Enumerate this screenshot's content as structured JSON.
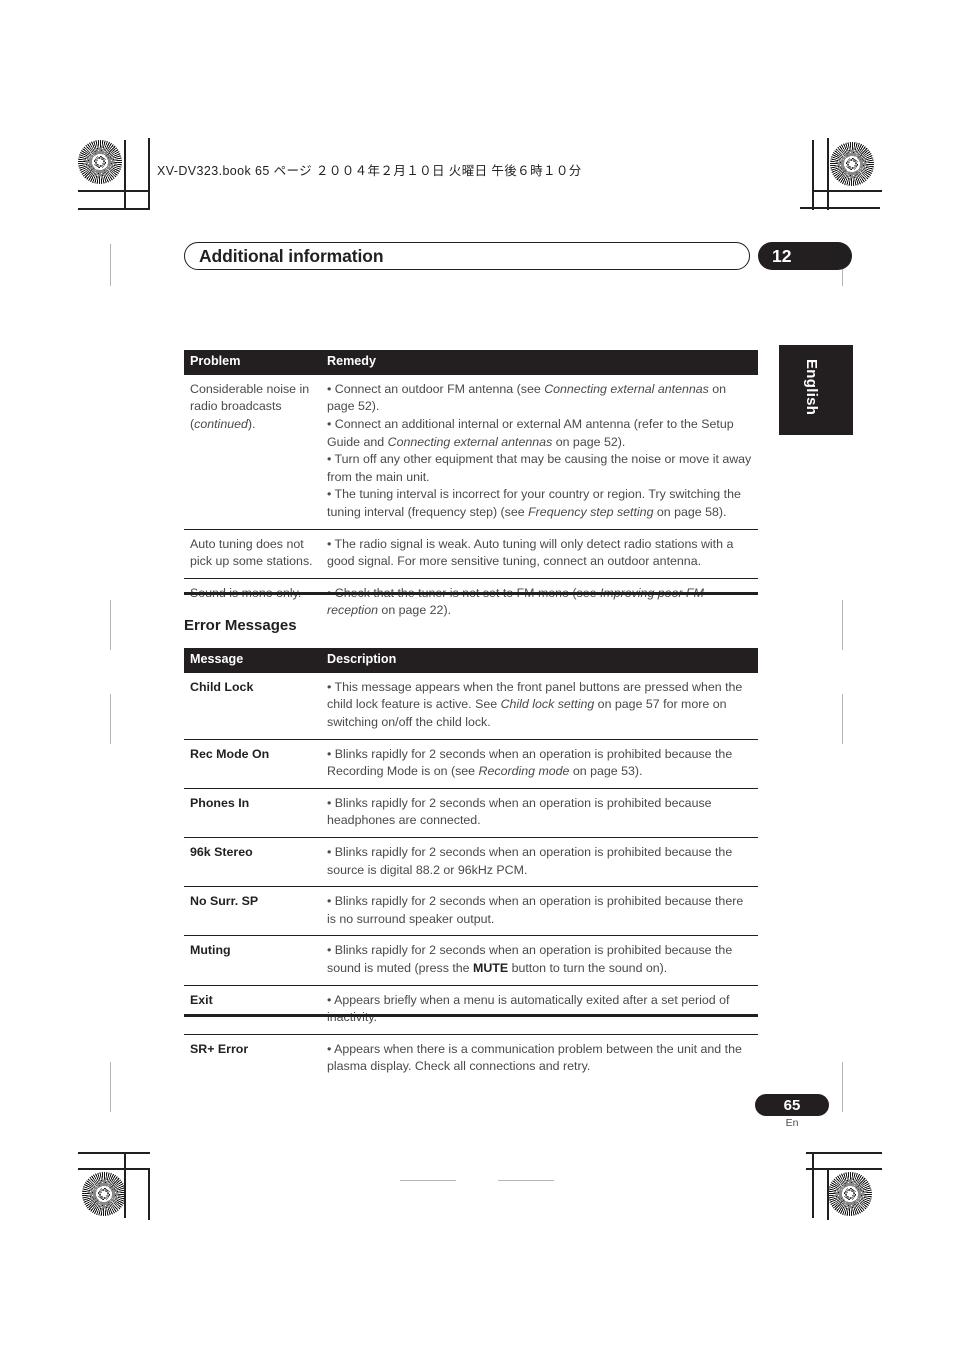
{
  "page": {
    "slug": "XV-DV323.book  65 ページ  ２００４年２月１０日  火曜日  午後６時１０分",
    "chapter_title": "Additional information",
    "chapter_number": "12",
    "language_tab": "English",
    "folio_number": "65",
    "folio_language": "En",
    "accent_color": "#231f20"
  },
  "troubleshooting_table": {
    "headers": [
      "Problem",
      "Remedy"
    ],
    "rows": [
      {
        "problem_line1": "Considerable noise in",
        "problem_line2": "radio broadcasts",
        "problem_line3_italic": "continued",
        "remedy_bullets": [
          {
            "pre": "• Connect an outdoor FM antenna (see ",
            "italic": "Connecting external antennas",
            "post": " on page 52)."
          },
          {
            "pre": "• Connect an additional internal or external AM antenna (refer to the Setup Guide and ",
            "italic": "Connecting external antennas",
            "post": " on page 52)."
          },
          {
            "pre": "• Turn off any other equipment that may be causing the noise or move it away from the main unit.",
            "italic": "",
            "post": ""
          },
          {
            "pre": "• The tuning interval is incorrect for your country or region. Try switching the tuning interval (frequency step) (see ",
            "italic": "Frequency step setting",
            "post": " on page 58)."
          }
        ]
      },
      {
        "problem": "Auto tuning does not pick up some stations.",
        "remedy_bullets": [
          {
            "pre": "• The radio signal is weak. Auto tuning will only detect radio stations with a good signal. For more sensitive tuning, connect an outdoor antenna.",
            "italic": "",
            "post": ""
          }
        ]
      },
      {
        "problem": "Sound is mono only.",
        "remedy_bullets": [
          {
            "pre": "• Check that the tuner is not set to FM mono (see ",
            "italic": "Improving poor FM reception",
            "post": " on page 22)."
          }
        ]
      }
    ]
  },
  "error_messages_section": {
    "heading": "Error Messages",
    "headers": [
      "Message",
      "Description"
    ],
    "rows": [
      {
        "message": "Child Lock",
        "pre": "• This message appears when the front panel buttons are pressed when the child lock feature is active. See ",
        "italic": "Child lock setting",
        "post": " on page 57 for more on switching on/off the child lock."
      },
      {
        "message": "Rec Mode On",
        "pre": "• Blinks rapidly for 2 seconds when an operation is prohibited because the Recording Mode is on (see ",
        "italic": "Recording mode",
        "post": " on page 53)."
      },
      {
        "message": "Phones In",
        "pre": "• Blinks rapidly for 2 seconds when an operation is prohibited because headphones are connected.",
        "italic": "",
        "post": ""
      },
      {
        "message": "96k Stereo",
        "pre": "• Blinks rapidly for 2 seconds when an operation is prohibited because the source is digital 88.2 or 96kHz PCM.",
        "italic": "",
        "post": ""
      },
      {
        "message": "No Surr. SP",
        "pre": "• Blinks rapidly for 2 seconds when an operation is prohibited because there is no surround speaker output.",
        "italic": "",
        "post": ""
      },
      {
        "message": "Muting",
        "pre": "• Blinks rapidly for 2 seconds when an operation is prohibited because the sound is muted (press the ",
        "bold": "MUTE",
        "post": " button to turn the sound on)."
      },
      {
        "message": "Exit",
        "pre": "• Appears briefly when a menu is automatically exited after a set period of inactivity.",
        "italic": "",
        "post": ""
      },
      {
        "message": "SR+ Error",
        "pre": "• Appears when there is a communication problem between the unit and the plasma display. Check all connections and retry.",
        "italic": "",
        "post": ""
      }
    ]
  }
}
